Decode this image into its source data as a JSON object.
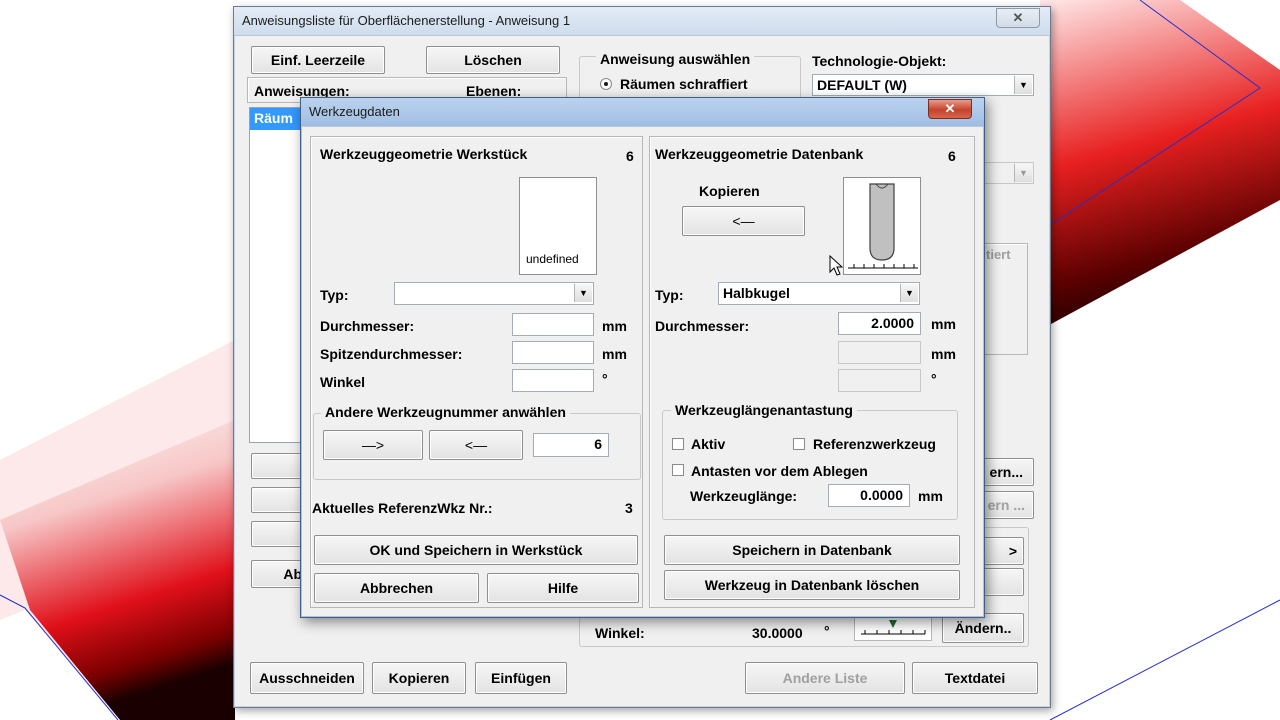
{
  "colors": {
    "surface_red": "#e0101a",
    "surface_dark": "#1a0000",
    "edge_blue": "#2030d0",
    "selection": "#3399ff"
  },
  "main_window": {
    "title": "Anweisungsliste für Oberflächenerstellung - Anweisung 1",
    "close_label": "✕",
    "insert_blank_button": "Einf. Leerzeile",
    "delete_button": "Löschen",
    "list_header_instructions": "Anweisungen:",
    "list_header_levels": "Ebenen:",
    "list_selected_item": "Räum",
    "select_group_title": "Anweisung auswählen",
    "radio_clearance_hatched": "Räumen schraffiert",
    "technology_label": "Technologie-Objekt:",
    "technology_value": "DEFAULT (W)",
    "partial_right_text": "tiert",
    "change_button_1": "ern...",
    "change_button_2": "ern ...",
    "arrow_button_partial": ">",
    "left_partial_button": "Ab",
    "angle_label": "Winkel:",
    "angle_value": "30.0000",
    "angle_unit": "°",
    "change_button_3": "Ändern..",
    "cut_button": "Ausschneiden",
    "copy_button": "Kopieren",
    "paste_button": "Einfügen",
    "other_list_button": "Andere Liste",
    "textfile_button": "Textdatei"
  },
  "dialog": {
    "title": "Werkzeugdaten",
    "close_label": "✕",
    "workpiece": {
      "heading": "Werkzeuggeometrie Werkstück",
      "count": "6",
      "preview_text": "undefined",
      "type_label": "Typ:",
      "type_value": "",
      "diameter_label": "Durchmesser:",
      "diameter_value": "",
      "diameter_unit": "mm",
      "tip_diameter_label": "Spitzendurchmesser:",
      "tip_diameter_value": "",
      "tip_diameter_unit": "mm",
      "angle_label": "Winkel",
      "angle_value": "",
      "angle_unit": "°"
    },
    "other_tool_group": {
      "title": "Andere Werkzeugnummer anwählen",
      "next_label": "—>",
      "prev_label": "<—",
      "number_value": "6"
    },
    "current_ref_label": "Aktuelles ReferenzWkz Nr.:",
    "current_ref_value": "3",
    "ok_save_button": "OK und Speichern in Werkstück",
    "cancel_button": "Abbrechen",
    "help_button": "Hilfe",
    "database": {
      "heading": "Werkzeuggeometrie Datenbank",
      "count": "6",
      "copy_label": "Kopieren",
      "copy_arrow": "<—",
      "type_label": "Typ:",
      "type_value": "Halbkugel",
      "diameter_label": "Durchmesser:",
      "diameter_value": "2.0000",
      "diameter_unit": "mm",
      "tip_unit": "mm",
      "angle_unit": "°"
    },
    "length_probe_group": {
      "title": "Werkzeuglängenantastung",
      "active_label": "Aktiv",
      "reference_tool_label": "Referenzwerkzeug",
      "probe_before_label": "Antasten vor dem Ablegen",
      "tool_length_label": "Werkzeuglänge:",
      "tool_length_value": "0.0000",
      "tool_length_unit": "mm"
    },
    "save_db_button": "Speichern in Datenbank",
    "delete_db_button": "Werkzeug in Datenbank löschen"
  }
}
